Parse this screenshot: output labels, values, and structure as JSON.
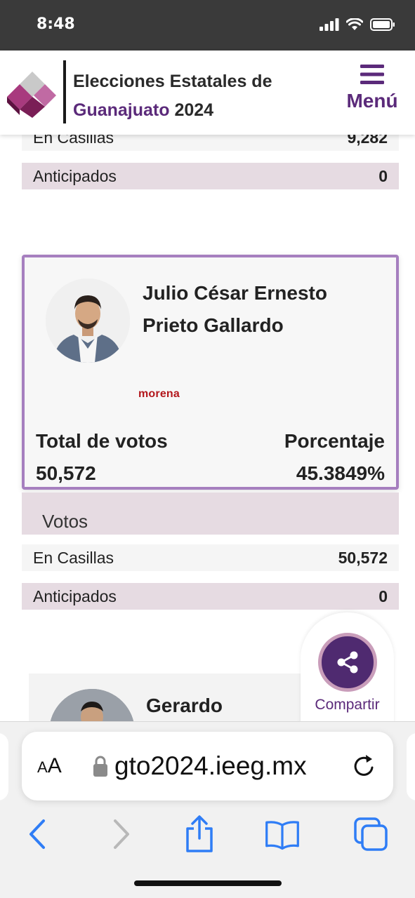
{
  "status_bar": {
    "time": "8:48"
  },
  "header": {
    "title_line1": "Elecciones Estatales de",
    "title_accent": "Guanajuato",
    "title_year": "2024",
    "menu_label": "Menú"
  },
  "prev_votes": {
    "rows": [
      {
        "label": "En Casillas",
        "value": "9,282"
      },
      {
        "label": "Anticipados",
        "value": "0"
      }
    ]
  },
  "candidate": {
    "name": "Julio César Ernesto Prieto Gallardo",
    "party": "morena",
    "total_label": "Total de votos",
    "total_value": "50,572",
    "pct_label": "Porcentaje",
    "pct_value": "45.3849%",
    "votes_header": "Votos",
    "rows": [
      {
        "label": "En Casillas",
        "value": "50,572"
      },
      {
        "label": "Anticipados",
        "value": "0"
      }
    ]
  },
  "next_candidate": {
    "name": "Gerardo"
  },
  "share": {
    "label": "Compartir"
  },
  "browser": {
    "aa_big": "A",
    "aa_small": "A",
    "url": "gto2024.ieeg.mx"
  },
  "colors": {
    "brand": "#5b2a7a",
    "card_border": "#a67fbf",
    "row_tint": "#e6dbe2",
    "party_red": "#b3171c"
  },
  "icons": [
    "signal-icon",
    "wifi-icon",
    "battery-icon",
    "menu-icon",
    "share-icon",
    "lock-icon",
    "reload-icon",
    "back-icon",
    "forward-icon",
    "share-sheet-icon",
    "bookmarks-icon",
    "tabs-icon"
  ]
}
